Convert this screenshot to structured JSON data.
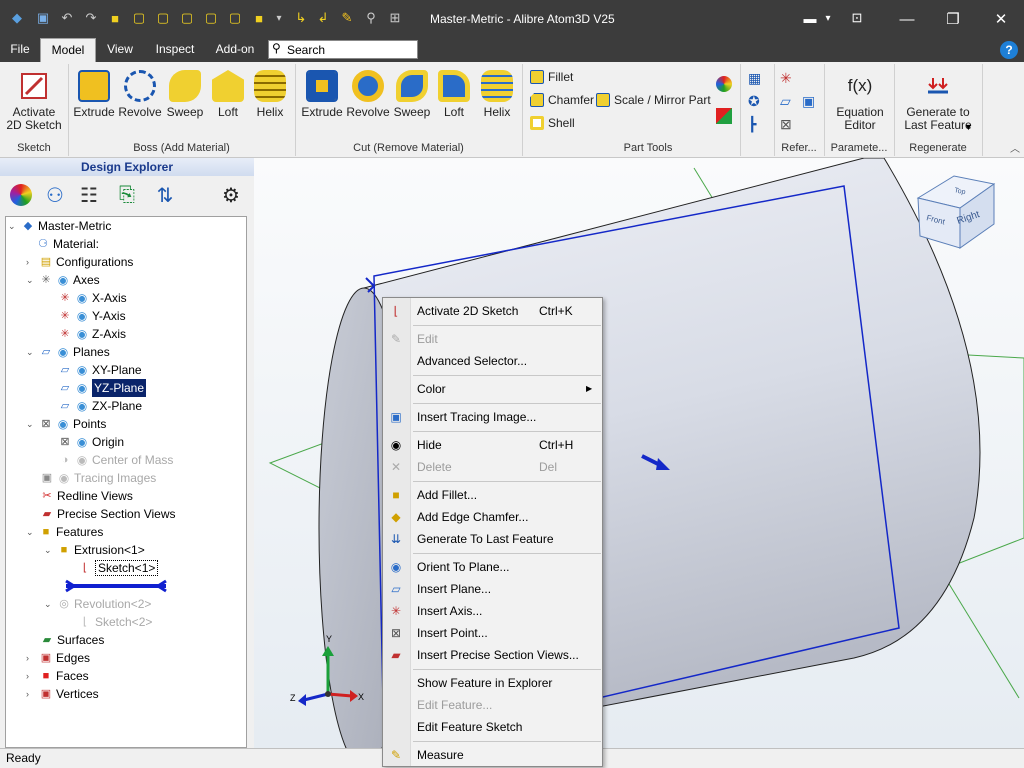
{
  "window": {
    "title": "Master-Metric - Alibre Atom3D V25",
    "minimize": "—",
    "maximize": "❐",
    "close": "✕"
  },
  "menu": {
    "tabs": [
      {
        "label": "File"
      },
      {
        "label": "Model"
      },
      {
        "label": "View"
      },
      {
        "label": "Inspect"
      },
      {
        "label": "Add-on"
      }
    ],
    "search_placeholder": "Search",
    "help": "?"
  },
  "ribbon": {
    "sketch": {
      "activate": "Activate\n2D Sketch",
      "group": "Sketch"
    },
    "boss": {
      "items": [
        "Extrude",
        "Revolve",
        "Sweep",
        "Loft",
        "Helix"
      ],
      "group": "Boss (Add Material)"
    },
    "cut": {
      "items": [
        "Extrude",
        "Revolve",
        "Sweep",
        "Loft",
        "Helix"
      ],
      "group": "Cut (Remove Material)"
    },
    "part_tools": {
      "fillet": "Fillet",
      "chamfer": "Chamfer",
      "scale": "Scale / Mirror Part",
      "shell": "Shell",
      "group": "Part Tools"
    },
    "refer": {
      "group": "Refer..."
    },
    "parameters": {
      "equation": "Equation\nEditor",
      "fx": "f(x)",
      "group": "Paramete..."
    },
    "regenerate": {
      "generate": "Generate to\nLast Feature",
      "group": "Regenerate"
    }
  },
  "explorer": {
    "title": "Design Explorer",
    "nodes": [
      {
        "label": "Master-Metric"
      },
      {
        "label": "Material:"
      },
      {
        "label": "Configurations"
      },
      {
        "label": "Axes"
      },
      {
        "label": "X-Axis"
      },
      {
        "label": "Y-Axis"
      },
      {
        "label": "Z-Axis"
      },
      {
        "label": "Planes"
      },
      {
        "label": "XY-Plane"
      },
      {
        "label": "YZ-Plane"
      },
      {
        "label": "ZX-Plane"
      },
      {
        "label": "Points"
      },
      {
        "label": "Origin"
      },
      {
        "label": "Center of Mass"
      },
      {
        "label": "Tracing Images"
      },
      {
        "label": "Redline Views"
      },
      {
        "label": "Precise Section Views"
      },
      {
        "label": "Features"
      },
      {
        "label": "Extrusion<1>"
      },
      {
        "label": "Sketch<1>"
      },
      {
        "label": "Revolution<2>"
      },
      {
        "label": "Sketch<2>"
      },
      {
        "label": "Surfaces"
      },
      {
        "label": "Edges"
      },
      {
        "label": "Faces"
      },
      {
        "label": "Vertices"
      }
    ]
  },
  "viewcube": {
    "top": "Top",
    "front": "Front",
    "right": "Right"
  },
  "triad": {
    "x": "X",
    "y": "Y",
    "z": "Z"
  },
  "context_menu": {
    "items": [
      {
        "label": "Activate 2D Sketch",
        "shortcut": "Ctrl+K"
      },
      {
        "label": "Edit"
      },
      {
        "label": "Advanced Selector..."
      },
      {
        "label": "Color"
      },
      {
        "label": "Insert Tracing Image..."
      },
      {
        "label": "Hide",
        "shortcut": "Ctrl+H"
      },
      {
        "label": "Delete",
        "shortcut": "Del"
      },
      {
        "label": "Add Fillet..."
      },
      {
        "label": "Add Edge Chamfer..."
      },
      {
        "label": "Generate To Last Feature"
      },
      {
        "label": "Orient To Plane..."
      },
      {
        "label": "Insert Plane..."
      },
      {
        "label": "Insert Axis..."
      },
      {
        "label": "Insert Point..."
      },
      {
        "label": "Insert Precise Section Views..."
      },
      {
        "label": "Show Feature in Explorer"
      },
      {
        "label": "Edit Feature..."
      },
      {
        "label": "Edit Feature Sketch"
      },
      {
        "label": "Measure"
      }
    ]
  },
  "status": {
    "text": "Ready"
  },
  "colors": {
    "titlebar": "#3c3c3c",
    "plane_blue": "#1428c8",
    "plane_green": "#4aa84a",
    "selection": "#0a246a"
  }
}
